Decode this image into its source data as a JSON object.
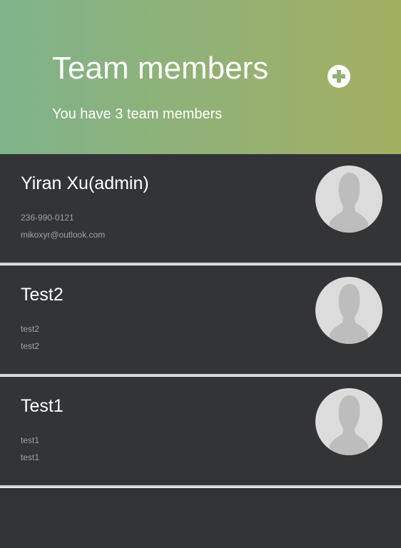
{
  "header": {
    "title": "Team members",
    "subtitle": "You have 3 team members",
    "add_icon": "plus-circle-icon"
  },
  "members": [
    {
      "name": "Yiran Xu(admin)",
      "phone": "236-990-0121",
      "email": "mikoxyr@outlook.com",
      "avatar_icon": "default-avatar-icon"
    },
    {
      "name": "Test2",
      "phone": "test2",
      "email": "test2",
      "avatar_icon": "default-avatar-icon"
    },
    {
      "name": "Test1",
      "phone": "test1",
      "email": "test1",
      "avatar_icon": "default-avatar-icon"
    }
  ],
  "colors": {
    "header_gradient_start": "#7fb38a",
    "header_gradient_end": "#a3b062",
    "background": "#333438",
    "avatar_bg": "#dcdcdc",
    "avatar_silhouette": "#bdbdbd"
  }
}
